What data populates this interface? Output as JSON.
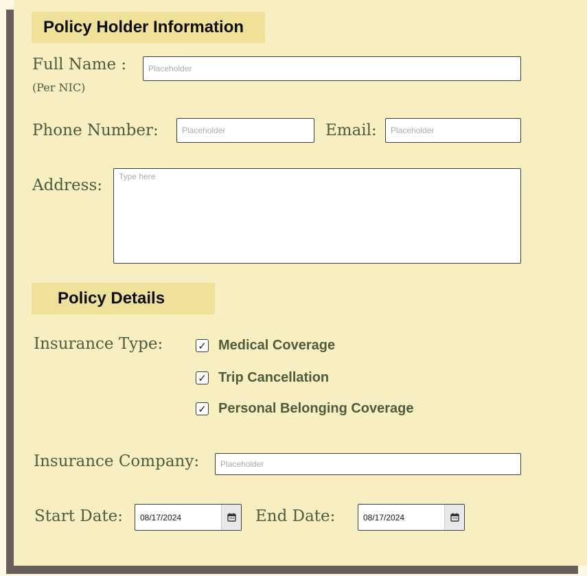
{
  "sections": {
    "holder_title": "Policy Holder Information",
    "details_title": "Policy Details"
  },
  "holder": {
    "full_name_label": "Full Name :",
    "full_name_sublabel": "(Per NIC)",
    "full_name_placeholder": "Placeholder",
    "phone_label": "Phone Number:",
    "phone_placeholder": "Placeholder",
    "email_label": "Email:",
    "email_placeholder": "Placeholder",
    "address_label": "Address:",
    "address_placeholder": "Type here"
  },
  "details": {
    "insurance_type_label": "Insurance Type:",
    "insurance_types": [
      {
        "label": "Medical Coverage",
        "checked": true
      },
      {
        "label": "Trip Cancellation",
        "checked": true
      },
      {
        "label": "Personal Belonging Coverage",
        "checked": true
      }
    ],
    "check_glyph": "✓",
    "company_label": "Insurance Company:",
    "company_placeholder": "Placeholder",
    "start_date_label": "Start Date:",
    "start_date_value": "08/17/2024",
    "end_date_label": "End Date:",
    "end_date_value": "08/17/2024",
    "calendar_icon": "calendar-icon"
  },
  "colors": {
    "card_bg": "#f7efc2",
    "header_bg": "#efe199",
    "label_color": "#4f5b3d",
    "shadow": "#685f5c"
  }
}
